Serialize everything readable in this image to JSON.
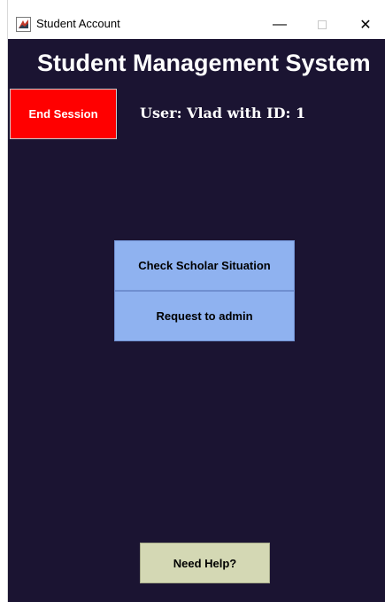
{
  "window": {
    "title": "Student Account",
    "icon": "java-app-icon",
    "controls": {
      "minimize_icon": "minimize-icon",
      "maximize_icon": "maximize-icon",
      "close_icon": "close-icon",
      "minimize_glyph": "—",
      "close_glyph": "✕"
    }
  },
  "header": {
    "title": "Student Management System"
  },
  "session": {
    "end_label": "End Session",
    "user_text": "User: Vlad with ID: 1"
  },
  "actions": {
    "scholar_label": "Check Scholar Situation",
    "request_label": "Request to admin"
  },
  "help": {
    "label": "Need Help?"
  },
  "colors": {
    "background": "#1b1432",
    "end_session": "#ff0000",
    "action_buttons": "#8fb2f0",
    "help_button": "#d4d8b4",
    "text_light": "#ffffff"
  }
}
